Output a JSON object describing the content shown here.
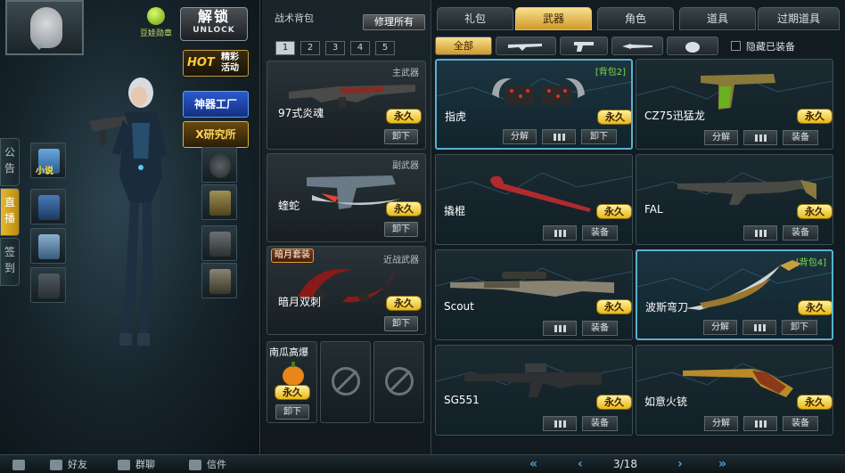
{
  "left": {
    "medal_label": "豆娃勋章",
    "unlock": {
      "big": "解锁",
      "small": "UNLOCK"
    },
    "hot": {
      "tag": "HOT",
      "text": "精彩活动"
    },
    "artifact_factory": "神器工厂",
    "x_lab": "X研究所",
    "side_tabs": [
      {
        "label": "公告"
      },
      {
        "label": "直播"
      },
      {
        "label": "签到"
      }
    ],
    "novel_label": "小说"
  },
  "middle": {
    "title": "战术背包",
    "repair_all": "修理所有",
    "bag_tabs": [
      "1",
      "2",
      "3",
      "4",
      "5"
    ],
    "slots": [
      {
        "type": "主武器",
        "name": "97式炎魂",
        "badge": "永久",
        "unequip": "卸下"
      },
      {
        "type": "副武器",
        "name": "蝰蛇",
        "badge": "永久",
        "unequip": "卸下"
      },
      {
        "type": "近战武器",
        "name": "暗月双刺",
        "badge": "永久",
        "unequip": "卸下",
        "suit": "暗月套装"
      }
    ],
    "grenade": {
      "name": "南瓜高爆",
      "badge": "永久",
      "unequip": "卸下"
    }
  },
  "right": {
    "category_tabs": [
      "礼包",
      "武器",
      "角色",
      "道具",
      "过期道具"
    ],
    "filter_all": "全部",
    "hide_equipped": "隐藏已装备",
    "items": [
      {
        "name": "指虎",
        "badge": "永久",
        "bag": "[背包2]",
        "buttons": [
          "分解",
          "",
          "卸下"
        ]
      },
      {
        "name": "CZ75迅猛龙",
        "badge": "永久",
        "bag": "",
        "buttons": [
          "分解",
          "",
          "装备"
        ]
      },
      {
        "name": "撬棍",
        "badge": "永久",
        "bag": "",
        "buttons": [
          "",
          "装备"
        ]
      },
      {
        "name": "FAL",
        "badge": "永久",
        "bag": "",
        "buttons": [
          "",
          "装备"
        ]
      },
      {
        "name": "Scout",
        "badge": "永久",
        "bag": "",
        "buttons": [
          "",
          "装备"
        ]
      },
      {
        "name": "波斯弯刀",
        "badge": "永久",
        "bag": "[背包4]",
        "buttons": [
          "分解",
          "",
          "卸下"
        ]
      },
      {
        "name": "SG551",
        "badge": "永久",
        "bag": "",
        "buttons": [
          "",
          "装备"
        ]
      },
      {
        "name": "如意火铳",
        "badge": "永久",
        "bag": "",
        "buttons": [
          "分解",
          "",
          "装备"
        ]
      }
    ],
    "page": "3/18"
  },
  "bottom": {
    "friends": "好友",
    "group_chat": "群聊",
    "mail": "信件"
  },
  "colors": {
    "accent_gold": "#e8b818",
    "selected_border": "#5ab0d0",
    "bag_tag_green": "#7adc4a"
  }
}
